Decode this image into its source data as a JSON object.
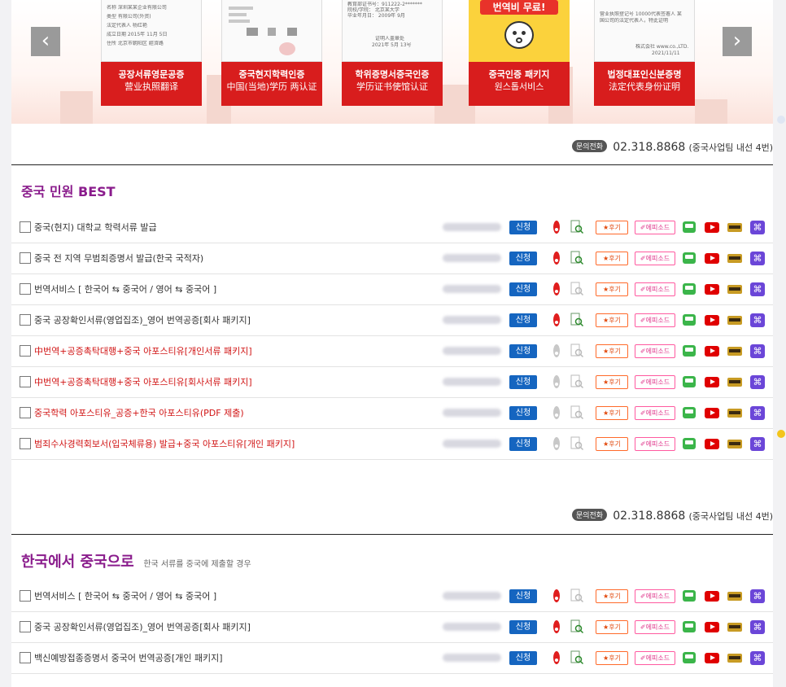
{
  "banner": {
    "prev_label": "‹",
    "next_label": "›",
    "cards": [
      {
        "line1": "공장서류영문공증",
        "line2": "营业执照翻译",
        "doc": [
          "名称 深圳某某企业有限公司",
          "类型 有限公司(外资)",
          "法定代表人 杨红艳",
          "成立日期 2015年 11月 5日",
          "住所 北京市朝阳区 經濟路"
        ]
      },
      {
        "line1": "중국현지학력인증",
        "line2": "中国(当地)学历 两认证",
        "doc": []
      },
      {
        "line1": "학위증명서중국인증",
        "line2": "学历证书使馆认证",
        "doc": [
          "教育部证书号：911222-2*******",
          "院校/学院： 北京某大学",
          "毕业年月日： 2009年 9月",
          "证明人盖章处",
          "2021年 5月 13号"
        ]
      },
      {
        "line1": "중국인증 패키지",
        "line2": "원스톱서비스",
        "doc": [
          "번역비 무료!"
        ]
      },
      {
        "line1": "법정대표인신분증명",
        "line2": "法定代表身份证明",
        "doc": [
          "营业执照登记号 10000代表签署人 某",
          "国公司的法定代表人，特此证明",
          "株式会社 www.co.,LTD.",
          "2021/11/11"
        ]
      }
    ]
  },
  "contact": {
    "badge": "문의전화",
    "phone": "02.318.8868",
    "note": "(중국사업팀 내선 4번)"
  },
  "section1": {
    "title": "중국 민원 BEST",
    "items": [
      {
        "name": "중국(현지) 대학교 학력서류 발급",
        "red": false,
        "info": true,
        "detail": true
      },
      {
        "name": "중국 전 지역 무범죄증명서 발급(한국 국적자)",
        "red": false,
        "info": true,
        "detail": true
      },
      {
        "name": "번역서비스 [ 한국어 ⇆ 중국어 / 영어 ⇆ 중국어 ]",
        "red": false,
        "info": true,
        "detail": false
      },
      {
        "name": "중국 공장확인서류(영업집조)_영어 번역공증[회사 패키지]",
        "red": false,
        "info": true,
        "detail": true
      },
      {
        "name": "中번역+공증촉탁대행+중국 아포스티유[개인서류 패키지]",
        "red": true,
        "info": false,
        "detail": false
      },
      {
        "name": "中번역+공증촉탁대행+중국 아포스티유[회사서류 패키지]",
        "red": true,
        "info": false,
        "detail": false
      },
      {
        "name": "중국학력 아포스티유_공증+한국 아포스티유(PDF 제출)",
        "red": true,
        "info": false,
        "detail": false
      },
      {
        "name": "범죄수사경력회보서(입국체류용) 발급+중국 아포스티유[개인 패키지]",
        "red": true,
        "info": false,
        "detail": false
      }
    ]
  },
  "section2": {
    "title": "한국에서 중국으로",
    "subtitle": "한국 서류를 중국에 제출할 경우",
    "items": [
      {
        "name": "번역서비스 [ 한국어 ⇆ 중국어 / 영어 ⇆ 중국어 ]",
        "red": false,
        "info": true,
        "detail": false
      },
      {
        "name": "중국 공장확인서류(영업집조)_영어 번역공증[회사 패키지]",
        "red": false,
        "info": true,
        "detail": true
      },
      {
        "name": "백신예방접종증명서 중국어 번역공증[개인 패키지]",
        "red": false,
        "info": true,
        "detail": true
      }
    ]
  },
  "row_labels": {
    "apply": "신청",
    "review": "★후기",
    "episode": "✐에피소드",
    "link": "⌘"
  },
  "icons": [
    "chevron-left-icon",
    "chevron-right-icon",
    "exclamation-icon",
    "magnifier-doc-icon",
    "blog-icon",
    "youtube-icon",
    "podcast-icon",
    "link-icon"
  ],
  "colors": {
    "apply": "#1565c0",
    "title": "#8a1c8c",
    "red_item": "#d11414",
    "banner_red": "#d81d1d"
  }
}
